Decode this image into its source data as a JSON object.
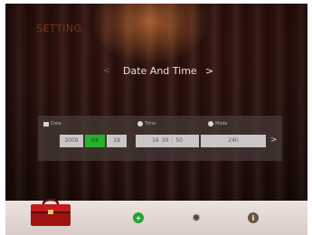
{
  "header": {
    "title": "SETTING"
  },
  "nav": {
    "prev_glyph": "<",
    "label": "Date And Time",
    "next_glyph": ">"
  },
  "panel": {
    "columns": {
      "date": "Date",
      "time": "Time",
      "mode": "Mode"
    },
    "date": {
      "year": "2009",
      "month": "04",
      "day": "18"
    },
    "time": {
      "hour": "16",
      "minute": "30",
      "second": "50",
      "separator": ":"
    },
    "mode": "24h",
    "next_glyph": ">"
  },
  "toolbar": {
    "icons": [
      "toolbox-icon",
      "add-icon",
      "gear-icon",
      "info-icon"
    ]
  },
  "colors": {
    "background": "#2b120d",
    "title": "#7a3019",
    "highlight": "#22b22b",
    "bar": "#e6dcd8"
  }
}
